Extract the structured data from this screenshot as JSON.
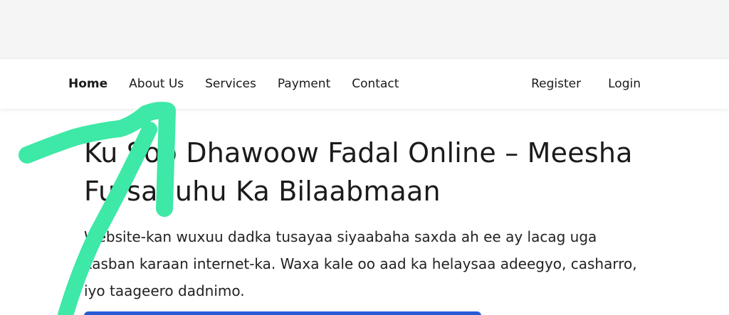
{
  "nav": {
    "left": [
      {
        "label": "Home",
        "active": true
      },
      {
        "label": "About Us"
      },
      {
        "label": "Services"
      },
      {
        "label": "Payment"
      },
      {
        "label": "Contact"
      }
    ],
    "right": [
      {
        "label": "Register"
      },
      {
        "label": "Login"
      }
    ]
  },
  "hero": {
    "title": "Ku Soo Dhawoow Fadal Online – Meesha Fursaduhu Ka Bilaabmaan",
    "description": "Website-kan wuxuu dadka tusayaa siyaabaha saxda ah ee ay lacag uga kasban karaan internet-ka. Waxa kale oo aad ka helaysaa adeegyo, casharro, iyo taageero dadnimo."
  },
  "colors": {
    "annotation": "#3ee8a6",
    "cta": "#2a5bd7"
  }
}
